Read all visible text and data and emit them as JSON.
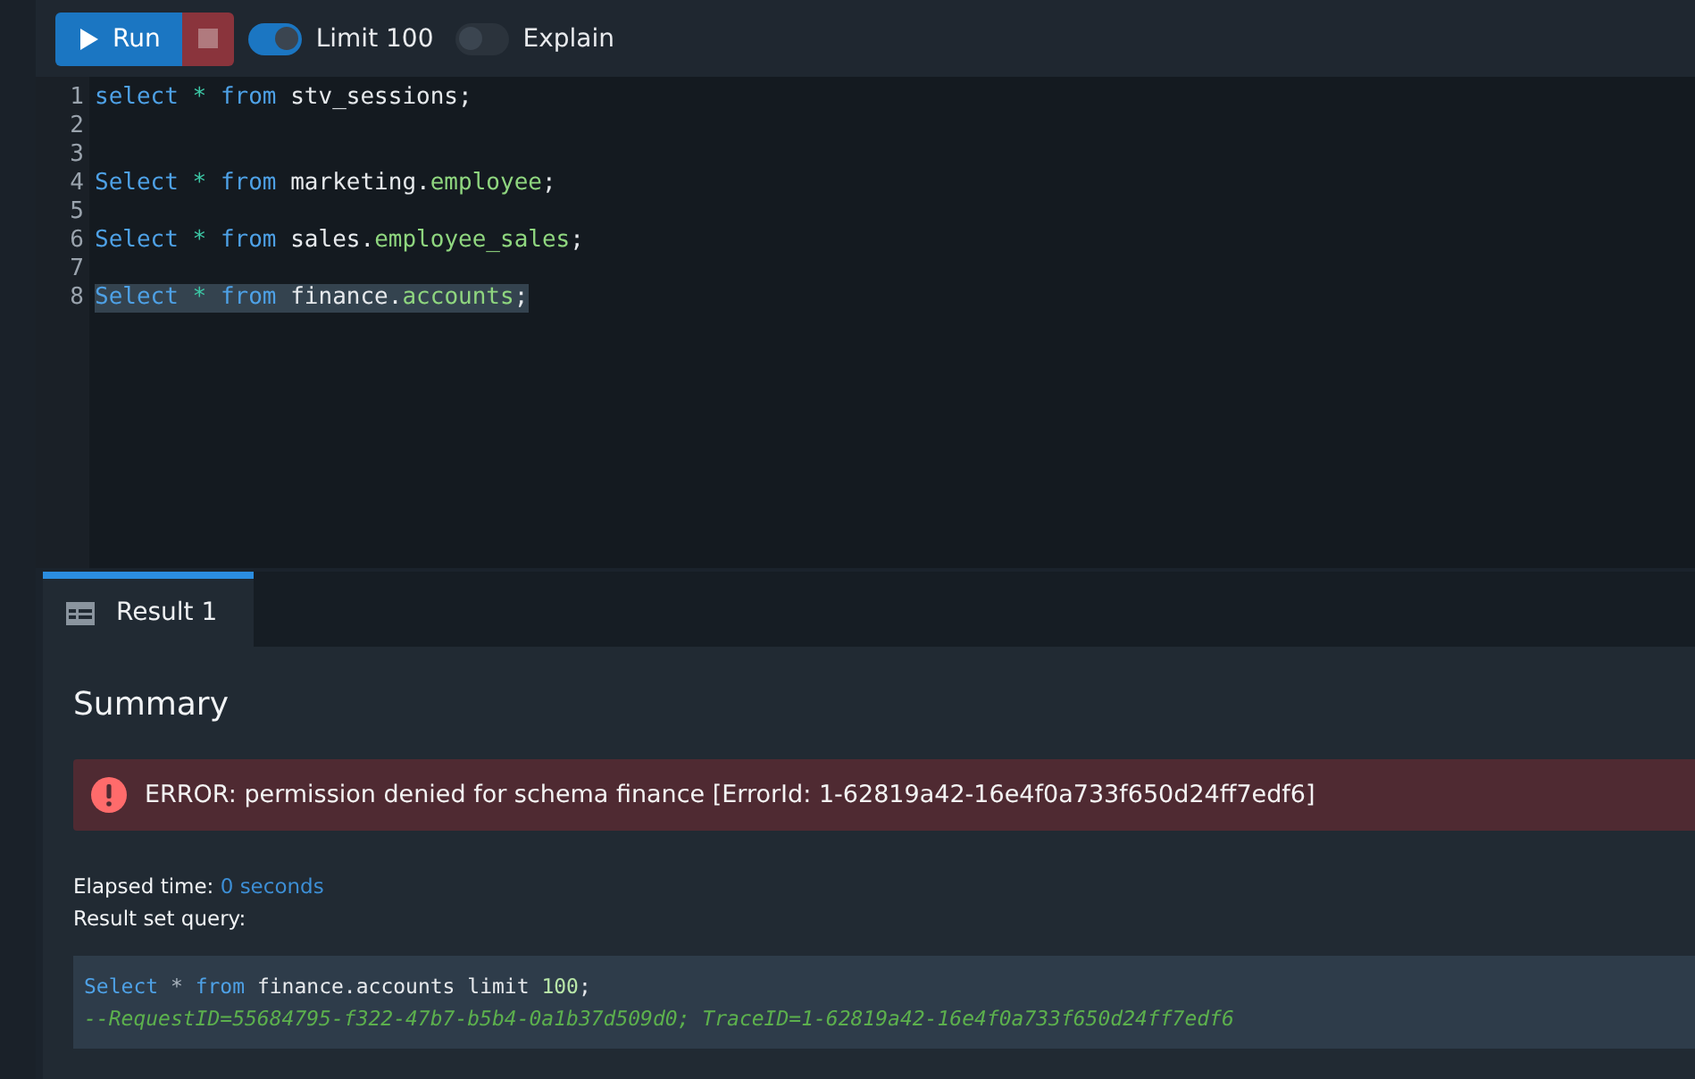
{
  "toolbar": {
    "run_button": {
      "label": "Run"
    },
    "stop_button": {
      "disabled": true
    },
    "toggles": [
      {
        "label": "Limit 100",
        "on": true
      },
      {
        "label": "Explain",
        "on": false
      }
    ]
  },
  "editor": {
    "lines": [
      {
        "number": "1",
        "selected": false,
        "tokens": [
          {
            "kind": "keyword",
            "text": "select"
          },
          {
            "kind": "star",
            "text": " * "
          },
          {
            "kind": "keyword",
            "text": "from"
          },
          {
            "kind": "ident",
            "text": " stv_sessions;"
          }
        ]
      },
      {
        "number": "2"
      },
      {
        "number": "3"
      },
      {
        "number": "4",
        "selected": false,
        "tokens": [
          {
            "kind": "keyword",
            "text": "Select"
          },
          {
            "kind": "star",
            "text": " * "
          },
          {
            "kind": "keyword",
            "text": "from"
          },
          {
            "kind": "ident",
            "text": " marketing."
          },
          {
            "kind": "member",
            "text": "employee"
          },
          {
            "kind": "ident",
            "text": ";"
          }
        ]
      },
      {
        "number": "5"
      },
      {
        "number": "6",
        "selected": false,
        "tokens": [
          {
            "kind": "keyword",
            "text": "Select"
          },
          {
            "kind": "star",
            "text": " * "
          },
          {
            "kind": "keyword",
            "text": "from"
          },
          {
            "kind": "ident",
            "text": " sales."
          },
          {
            "kind": "member",
            "text": "employee_sales"
          },
          {
            "kind": "ident",
            "text": ";"
          }
        ]
      },
      {
        "number": "7"
      },
      {
        "number": "8",
        "selected": true,
        "tokens": [
          {
            "kind": "keyword",
            "text": "Select"
          },
          {
            "kind": "star",
            "text": " * "
          },
          {
            "kind": "keyword",
            "text": "from"
          },
          {
            "kind": "ident",
            "text": " finance."
          },
          {
            "kind": "member",
            "text": "accounts"
          },
          {
            "kind": "ident",
            "text": ";"
          }
        ]
      }
    ]
  },
  "result_tabs": [
    {
      "label": "Result 1",
      "selected": true
    }
  ],
  "summary": {
    "title": "Summary",
    "error": "ERROR: permission denied for schema finance [ErrorId: 1-62819a42-16e4f0a733f650d24ff7edf6]",
    "elapsed_label": "Elapsed time:",
    "elapsed_value": "0 seconds",
    "query_label": "Result set query:",
    "query_lines": [
      [
        {
          "kind": "keyword",
          "text": "Select"
        },
        {
          "kind": "plain",
          "text": " * "
        },
        {
          "kind": "keyword",
          "text": "from"
        },
        {
          "kind": "ident",
          "text": " finance.accounts limit "
        },
        {
          "kind": "number",
          "text": "100"
        },
        {
          "kind": "ident",
          "text": ";"
        }
      ],
      [
        {
          "kind": "comment",
          "text": "--RequestID=55684795-f322-47b7-b5b4-0a1b37d509d0; TraceID=1-62819a42-16e4f0a733f650d24ff7edf6"
        }
      ]
    ]
  }
}
